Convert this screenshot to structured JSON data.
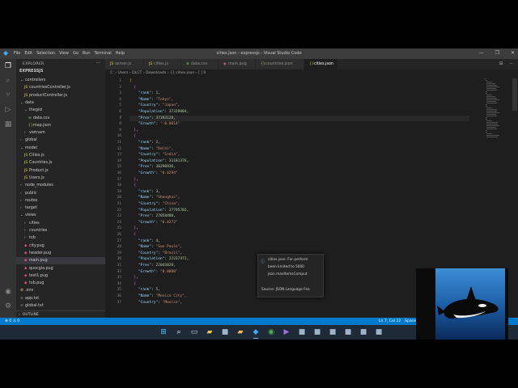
{
  "window": {
    "title": "cities.json - expressjs - Visual Studio Code",
    "menu": [
      "File",
      "Edit",
      "Selection",
      "View",
      "Go",
      "Run",
      "Terminal",
      "Help"
    ],
    "controls": [
      "—",
      "❐",
      "✕"
    ]
  },
  "activity_icons": [
    "explorer-icon",
    "search-icon",
    "source-control-icon",
    "run-debug-icon",
    "extensions-icon",
    "account-icon",
    "manage-icon"
  ],
  "sidebar": {
    "header": "EXPLORER",
    "more": "···",
    "project": "EXPRESSJS",
    "outline": "OUTLINE",
    "tree": [
      {
        "label": "controllers",
        "kind": "folder",
        "open": true,
        "indent": 1
      },
      {
        "label": "countriesController.js",
        "kind": "js",
        "indent": 2
      },
      {
        "label": "productController.js",
        "kind": "js",
        "indent": 2
      },
      {
        "label": "data",
        "kind": "folder",
        "open": true,
        "indent": 1
      },
      {
        "label": "thegioi",
        "kind": "folder",
        "open": true,
        "indent": 2
      },
      {
        "label": "data.csv",
        "kind": "csv",
        "indent": 3
      },
      {
        "label": "map.json",
        "kind": "json",
        "indent": 3
      },
      {
        "label": "vietnam",
        "kind": "folder",
        "open": false,
        "indent": 2
      },
      {
        "label": "global",
        "kind": "folder",
        "open": false,
        "indent": 1
      },
      {
        "label": "model",
        "kind": "folder",
        "open": true,
        "indent": 1
      },
      {
        "label": "Cities.js",
        "kind": "js",
        "indent": 2
      },
      {
        "label": "Countries.js",
        "kind": "js",
        "indent": 2
      },
      {
        "label": "Product.js",
        "kind": "js",
        "indent": 2
      },
      {
        "label": "Users.js",
        "kind": "js",
        "indent": 2
      },
      {
        "label": "node_modules",
        "kind": "folder",
        "open": false,
        "indent": 1
      },
      {
        "label": "public",
        "kind": "folder",
        "open": false,
        "indent": 1
      },
      {
        "label": "routes",
        "kind": "folder",
        "open": false,
        "indent": 1
      },
      {
        "label": "target",
        "kind": "folder",
        "open": false,
        "indent": 1
      },
      {
        "label": "views",
        "kind": "folder",
        "open": true,
        "indent": 1
      },
      {
        "label": "cities",
        "kind": "folder",
        "open": false,
        "indent": 2
      },
      {
        "label": "countries",
        "kind": "folder",
        "open": false,
        "indent": 2
      },
      {
        "label": "tvb",
        "kind": "folder",
        "open": false,
        "indent": 2
      },
      {
        "label": "city.pug",
        "kind": "pug",
        "indent": 2
      },
      {
        "label": "header.pug",
        "kind": "pug",
        "indent": 2
      },
      {
        "label": "main.pug",
        "kind": "pug",
        "indent": 2,
        "selected": true
      },
      {
        "label": "quocgia.pug",
        "kind": "pug",
        "indent": 2
      },
      {
        "label": "test1.pug",
        "kind": "pug",
        "indent": 2
      },
      {
        "label": "tvb.pug",
        "kind": "pug",
        "indent": 2
      },
      {
        "label": ".env",
        "kind": "env",
        "indent": 1
      },
      {
        "label": "app.txt",
        "kind": "txt",
        "indent": 1
      },
      {
        "label": "global.txt",
        "kind": "txt",
        "indent": 1
      }
    ]
  },
  "tabs": [
    {
      "label": "server.js",
      "kind": "js"
    },
    {
      "label": "cities.js",
      "kind": "js"
    },
    {
      "label": "data.csv",
      "kind": "csv"
    },
    {
      "label": "main.pug",
      "kind": "pug"
    },
    {
      "label": "countries.json",
      "kind": "json"
    },
    {
      "label": "cities.json",
      "kind": "json",
      "active": true
    }
  ],
  "tab_actions": [
    "⊟",
    "···"
  ],
  "breadcrumb": "C: › Users › DLCT › Downloads › {} cities.json › [ ] 0",
  "code": {
    "current_line": 7,
    "lines": [
      "[",
      "  {",
      "    \"rank\": 1,",
      "    \"Name\": \"Tokyo\",",
      "    \"Country\": \"Japan\",",
      "    \"Population\": 37339804,",
      "    \"Prev\": 37393128,",
      "    \"Growth\": \"-0.0014\"",
      "  },",
      "  {",
      "    \"rank\": 2,",
      "    \"Name\": \"Delhi\",",
      "    \"Country\": \"India\",",
      "    \"Population\": 31181376,",
      "    \"Prev\": 30290936,",
      "    \"Growth\": \"0.0294\"",
      "  },",
      "  {",
      "    \"rank\": 3,",
      "    \"Name\": \"Shanghai\",",
      "    \"Country\": \"China\",",
      "    \"Population\": 27795702,",
      "    \"Prev\": 27058480,",
      "    \"Growth\": \"0.0272\"",
      "  },",
      "  {",
      "    \"rank\": 4,",
      "    \"Name\": \"Sao Paulo\",",
      "    \"Country\": \"Brazil\",",
      "    \"Population\": 22237472,",
      "    \"Prev\": 22043028,",
      "    \"Growth\": \"0.0088\"",
      "  },",
      "  {",
      "    \"rank\": 5,",
      "    \"Name\": \"Mexico City\",",
      "    \"Country\": \"Mexico\","
    ]
  },
  "notification": {
    "icon": "ⓘ",
    "lines": [
      "cities.json: For perform",
      "been limited to 5000",
      "json.maxItemsComput"
    ],
    "source": "Source: JSON Language Fea"
  },
  "statusbar": {
    "left": "⊗ 0 ⚠ 0",
    "position": "Ln 7, Col 22",
    "spaces": "Spaces"
  },
  "taskbar_icons": [
    "windows-start-icon",
    "search-icon",
    "task-view-icon",
    "file-explorer-icon",
    "app-icon",
    "folder-icon",
    "vscode-icon",
    "chrome-icon",
    "visual-studio-icon",
    "app-icon",
    "app-icon",
    "app-icon",
    "app-icon",
    "app-icon",
    "app-icon"
  ],
  "colors": {
    "statusbar": "#007acc",
    "editor_bg": "#1e1e1e",
    "sidebar_bg": "#252526",
    "json_key": "#9cdcfe",
    "json_string": "#ce9178",
    "json_number": "#b5cea8"
  }
}
